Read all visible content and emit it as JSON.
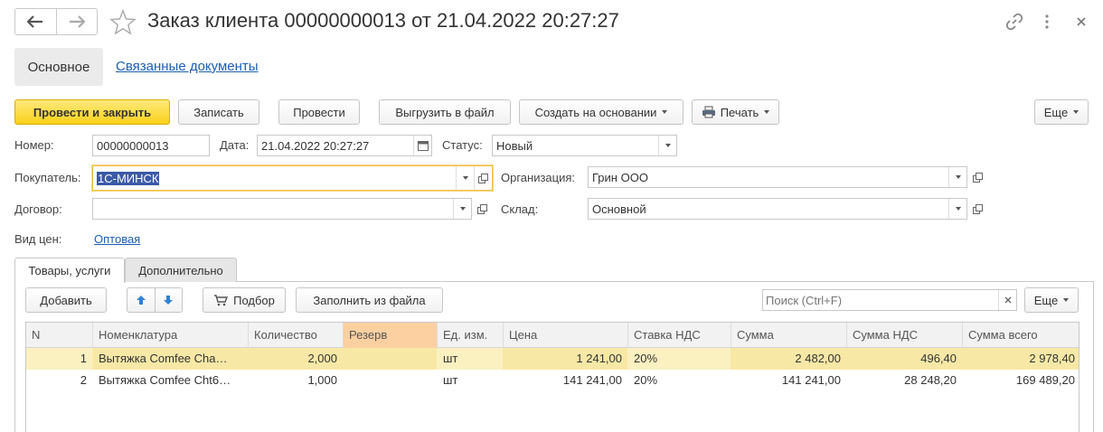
{
  "header": {
    "title": "Заказ клиента 00000000013 от 21.04.2022 20:27:27"
  },
  "section_tabs": {
    "main": "Основное",
    "related": "Связанные документы"
  },
  "toolbar": {
    "post_close": "Провести и закрыть",
    "write": "Записать",
    "post": "Провести",
    "export": "Выгрузить в файл",
    "create_based": "Создать на основании",
    "print": "Печать",
    "more": "Еще"
  },
  "form": {
    "number_label": "Номер:",
    "number_value": "00000000013",
    "date_label": "Дата:",
    "date_value": "21.04.2022 20:27:27",
    "status_label": "Статус:",
    "status_value": "Новый",
    "buyer_label": "Покупатель:",
    "buyer_value": "1С-МИНСК",
    "org_label": "Организация:",
    "org_value": "Грин ООО",
    "contract_label": "Договор:",
    "contract_value": "",
    "warehouse_label": "Склад:",
    "warehouse_value": "Основной",
    "price_type_label": "Вид цен:",
    "price_type_value": "Оптовая"
  },
  "page_tabs": {
    "goods": "Товары, услуги",
    "extra": "Дополнительно"
  },
  "table_toolbar": {
    "add": "Добавить",
    "pick": "Подбор",
    "fill_from_file": "Заполнить из файла",
    "search_placeholder": "Поиск (Ctrl+F)",
    "more": "Еще"
  },
  "table": {
    "columns": [
      "N",
      "Номенклатура",
      "Количество",
      "Резерв",
      "Ед. изм.",
      "Цена",
      "Ставка НДС",
      "Сумма",
      "Сумма НДС",
      "Сумма всего"
    ],
    "rows": [
      [
        "1",
        "Вытяжка Comfee Cha…",
        "2,000",
        "",
        "шт",
        "1 241,00",
        "20%",
        "2 482,00",
        "496,40",
        "2 978,40"
      ],
      [
        "2",
        "Вытяжка Comfee Cht6…",
        "1,000",
        "",
        "шт",
        "141 241,00",
        "20%",
        "141 241,00",
        "28 248,20",
        "169 489,20"
      ]
    ]
  }
}
